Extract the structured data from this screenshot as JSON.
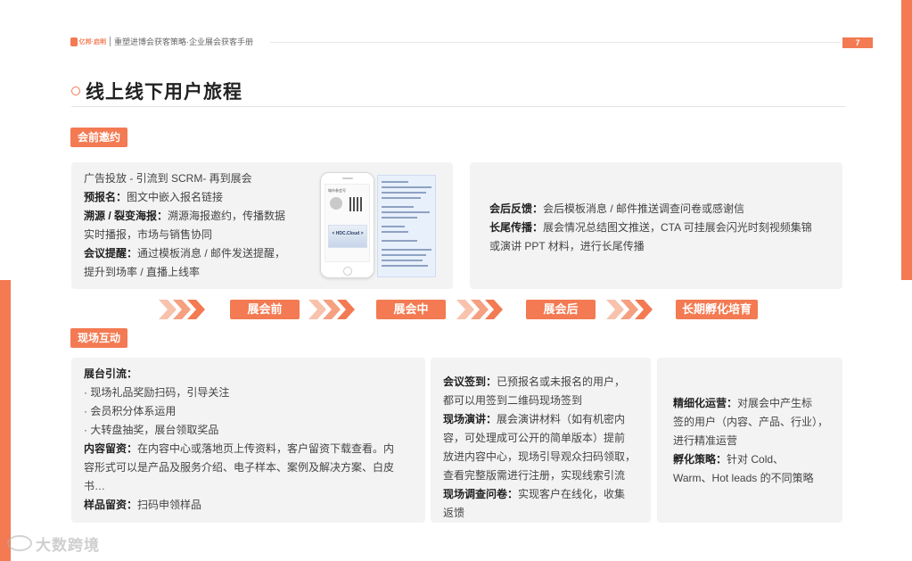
{
  "header": {
    "logo_text": "亿邦·启明",
    "doc_title": "重塑进博会获客策略·企业展会获客手册",
    "page_number": "7"
  },
  "title": "线上线下用户旅程",
  "tags": {
    "pre_invite": "会前邀约",
    "onsite": "现场互动"
  },
  "card_pre": {
    "line1": "广告投放 - 引流到 SCRM- 再到展会",
    "l2_b": "预报名：",
    "l2": "图文中嵌入报名链接",
    "l3_b": "溯源 / 裂变海报：",
    "l3": "溯源海报邀约，传播数据",
    "l4": "实时播报，市场与销售协同",
    "l5_b": "会议提醒：",
    "l5": "通过模板消息 / 邮件发送提醒，",
    "l6": "提升到场率 / 直播上线率",
    "phone_banner": "< HDC.Cloud >",
    "phone_name": "城市参会号"
  },
  "card_post": {
    "l1_b": "会后反馈：",
    "l1": "会后模板消息 / 邮件推送调查问卷或感谢信",
    "l2_b": "长尾传播：",
    "l2": "展会情况总结图文推送，CTA 可挂展会闪光时刻视频集锦",
    "l3": "或演讲 PPT 材料，进行长尾传播"
  },
  "stages": {
    "s1": "展会前",
    "s2": "展会中",
    "s3": "展会后",
    "s4": "长期孵化培育"
  },
  "card_booth": {
    "h_b": "展台引流：",
    "i1": "· 现场礼品奖励扫码，引导关注",
    "i2": "· 会员积分体系运用",
    "i3": "· 大转盘抽奖，展台领取奖品",
    "c1_b": "内容留资：",
    "c1": "在内容中心或落地页上传资料，客户留资下载查看。内",
    "c2": "容形式可以是产品及服务介绍、电子样本、案例及解决方案、白皮",
    "c3": "书…",
    "s_b": "样品留资：",
    "s": "扫码申领样品"
  },
  "card_meeting": {
    "a_b": "会议签到：",
    "a1": "已预报名或未报名的用户，",
    "a2": "都可以用签到二维码现场签到",
    "b_b": "现场演讲：",
    "b1": "展会演讲材料（如有机密内",
    "b2": "容，可处理成可公开的简单版本）提前",
    "b3": "放进内容中心，现场引导观众扫码领取，",
    "b4": "查看完整版需进行注册，实现线索引流",
    "c_b": "现场调查问卷：",
    "c1": "实现客户在线化，收集",
    "c2": "返馈"
  },
  "card_nurture": {
    "a_b": "精细化运营：",
    "a1": "对展会中产生标",
    "a2": "签的用户（内容、产品、行业），",
    "a3": "进行精准运营",
    "b_b": "孵化策略：",
    "b1": "针对 Cold、",
    "b2": "Warm、Hot leads 的不同策略"
  },
  "watermark": "大数跨境",
  "colors": {
    "accent": "#f37a52",
    "card_bg": "#f3f3f4"
  }
}
